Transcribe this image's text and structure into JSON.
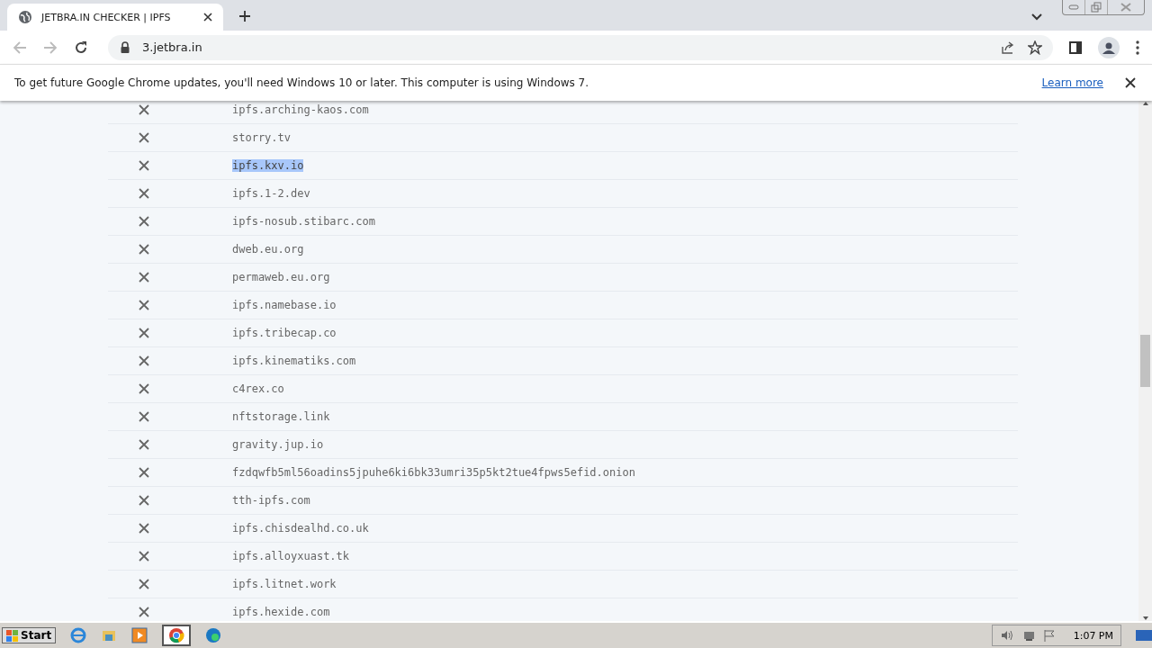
{
  "tab": {
    "title": "JETBRA.IN CHECKER | IPFS"
  },
  "address_bar": {
    "url": "3.jetbra.in"
  },
  "infobar": {
    "message": "To get future Google Chrome updates, you'll need Windows 10 or later. This computer is using Windows 7.",
    "link": "Learn more"
  },
  "rows": [
    {
      "host": "ipfs.arching-kaos.com",
      "selected": false
    },
    {
      "host": "storry.tv",
      "selected": false
    },
    {
      "host": "ipfs.kxv.io",
      "selected": true
    },
    {
      "host": "ipfs.1-2.dev",
      "selected": false
    },
    {
      "host": "ipfs-nosub.stibarc.com",
      "selected": false
    },
    {
      "host": "dweb.eu.org",
      "selected": false
    },
    {
      "host": "permaweb.eu.org",
      "selected": false
    },
    {
      "host": "ipfs.namebase.io",
      "selected": false
    },
    {
      "host": "ipfs.tribecap.co",
      "selected": false
    },
    {
      "host": "ipfs.kinematiks.com",
      "selected": false
    },
    {
      "host": "c4rex.co",
      "selected": false
    },
    {
      "host": "nftstorage.link",
      "selected": false
    },
    {
      "host": "gravity.jup.io",
      "selected": false
    },
    {
      "host": "fzdqwfb5ml56oadins5jpuhe6ki6bk33umri35p5kt2tue4fpws5efid.onion",
      "selected": false
    },
    {
      "host": "tth-ipfs.com",
      "selected": false
    },
    {
      "host": "ipfs.chisdealhd.co.uk",
      "selected": false
    },
    {
      "host": "ipfs.alloyxuast.tk",
      "selected": false
    },
    {
      "host": "ipfs.litnet.work",
      "selected": false
    },
    {
      "host": "ipfs.hexide.com",
      "selected": false
    }
  ],
  "taskbar": {
    "start": "Start",
    "clock": "1:07 PM"
  }
}
